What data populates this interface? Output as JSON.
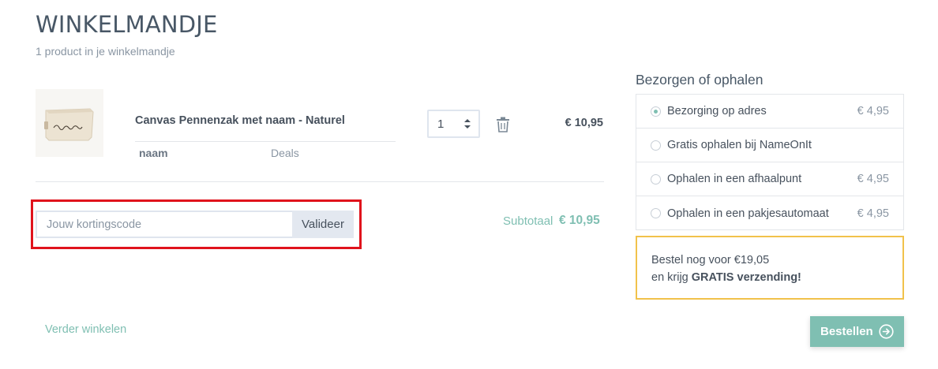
{
  "header": {
    "title": "WINKELMANDJE",
    "subtitle": "1 product in je winkelmandje"
  },
  "cart": {
    "items": [
      {
        "name": "Canvas Pennenzak met naam - Naturel",
        "option_label": "naam",
        "option_value": "Deals",
        "quantity": "1",
        "price": "€ 10,95",
        "thumbnail_text": "Juf Tamara"
      }
    ]
  },
  "coupon": {
    "placeholder": "Jouw kortingscode",
    "button_label": "Valideer"
  },
  "subtotal": {
    "label": "Subtotaal",
    "value": "€ 10,95"
  },
  "continue_label": "Verder winkelen",
  "delivery": {
    "title": "Bezorgen of ophalen",
    "options": [
      {
        "label": "Bezorging op adres",
        "price": "€ 4,95",
        "selected": true
      },
      {
        "label": "Gratis ophalen bij NameOnIt",
        "price": "",
        "selected": false
      },
      {
        "label": "Ophalen in een afhaalpunt",
        "price": "€ 4,95",
        "selected": false
      },
      {
        "label": "Ophalen in een pakjesautomaat",
        "price": "€ 4,95",
        "selected": false
      }
    ]
  },
  "promo": {
    "line1": "Bestel nog voor €19,05",
    "line2_prefix": "en krijg ",
    "line2_bold": "GRATIS verzending!"
  },
  "order_button_label": "Bestellen",
  "colors": {
    "accent": "#7fbfb2",
    "highlight": "#e0131c",
    "promo_border": "#f1c24b"
  }
}
